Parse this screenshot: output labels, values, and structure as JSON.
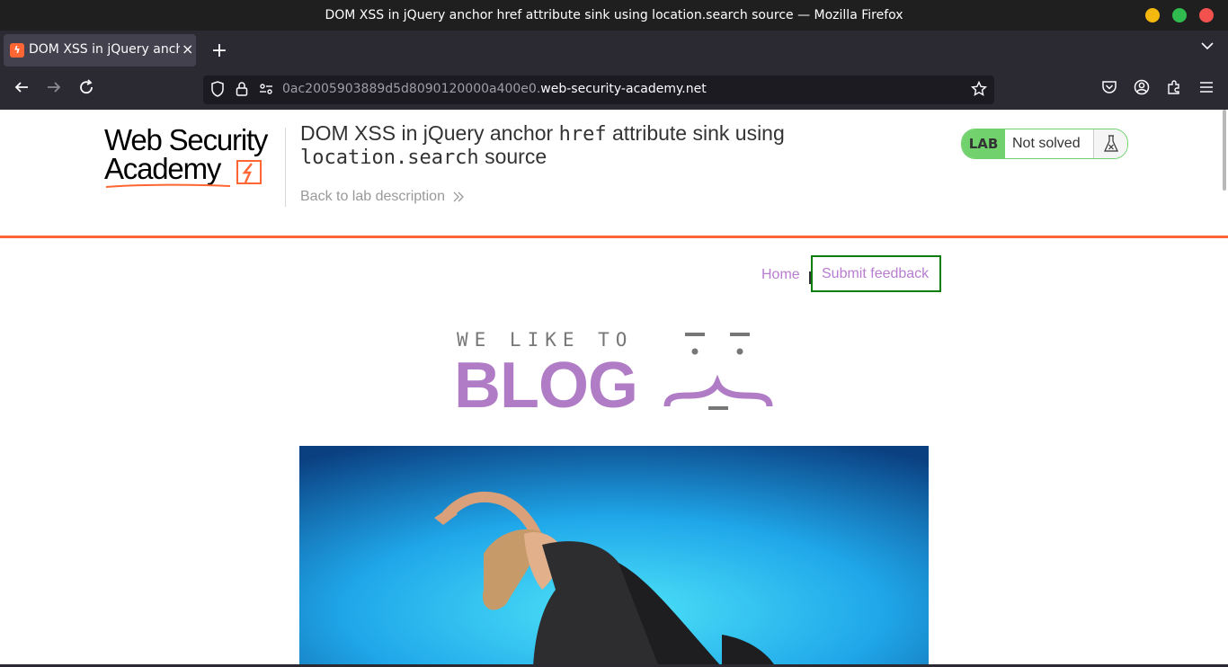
{
  "window": {
    "title": "DOM XSS in jQuery anchor href attribute sink using location.search source — Mozilla Firefox",
    "controls": {
      "minimize_color": "#f5b80f",
      "maximize_color": "#2fbb4f",
      "close_color": "#f2514e"
    }
  },
  "browser": {
    "tab": {
      "label": "DOM XSS in jQuery ancho",
      "favicon": "lab-icon",
      "close": "×"
    },
    "new_tab": "+",
    "tab_list": "⌄",
    "url": {
      "prefix": "0ac2005903889d5d8090120000a400e0.",
      "domain": "web-security-academy.net"
    },
    "nav_icons": [
      "back-arrow-icon",
      "forward-arrow-icon",
      "reload-icon",
      "shield-icon",
      "lock-icon",
      "permissions-icon",
      "bookmark-star-icon",
      "pocket-icon",
      "account-icon",
      "extensions-icon",
      "menu-icon"
    ]
  },
  "header": {
    "logo_line1": "Web Security",
    "logo_line2": "Academy",
    "title_part1": "DOM XSS in jQuery anchor ",
    "title_code1": "href",
    "title_part2": " attribute sink using",
    "title_code2": "location.search",
    "title_part3": " source",
    "back_link": "Back to lab description",
    "back_link_icon": "double-chevron-right-icon"
  },
  "lab_status": {
    "badge": "LAB",
    "status": "Not solved",
    "icon": "flask-icon",
    "accent_color": "#70d16d"
  },
  "colors": {
    "brand_orange": "#ff6633",
    "link_purple": "#b87dd0",
    "blog_purple": "#b07cc6",
    "focus_green": "#0a7d0a"
  },
  "site_nav": {
    "home": "Home",
    "submit_feedback": "Submit feedback"
  },
  "blog_banner": {
    "tagline": "WE LIKE TO",
    "word": "BLOG"
  },
  "hero_image": {
    "description_icon": "woman-stretching-image"
  }
}
